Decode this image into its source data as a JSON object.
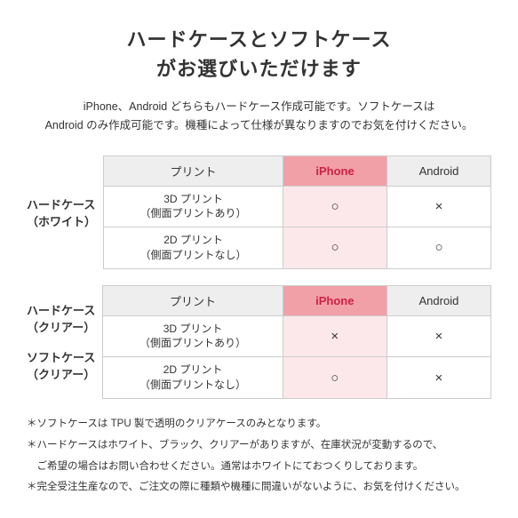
{
  "title": {
    "line1": "ハードケースとソフトケース",
    "line2": "がお選びいただけます"
  },
  "description": "iPhone、Android どちらもハードケース作成可能です。ソフトケースは\nAndroid のみ作成可能です。機種によって仕様が異なりますのでお気を付けください。",
  "table1": {
    "row_label_line1": "ハードケース",
    "row_label_line2": "（ホワイト）",
    "col_print": "プリント",
    "col_iphone": "iPhone",
    "col_android": "Android",
    "rows": [
      {
        "print_line1": "3D プリント",
        "print_line2": "（側面プリントあり）",
        "iphone": "○",
        "android": "×"
      },
      {
        "print_line1": "2D プリント",
        "print_line2": "（側面プリントなし）",
        "iphone": "○",
        "android": "○"
      }
    ]
  },
  "table2": {
    "row_label_line1": "ハードケース",
    "row_label_line2": "（クリアー）",
    "row_label2_line1": "ソフトケース",
    "row_label2_line2": "（クリアー）",
    "col_print": "プリント",
    "col_iphone": "iPhone",
    "col_android": "Android",
    "rows": [
      {
        "print_line1": "3D プリント",
        "print_line2": "（側面プリントあり）",
        "iphone": "×",
        "android": "×"
      },
      {
        "print_line1": "2D プリント",
        "print_line2": "（側面プリントなし）",
        "iphone": "○",
        "android": "×"
      }
    ]
  },
  "notes": [
    "＊ソフトケースは TPU 製で透明のクリアケースのみとなります。",
    "＊ハードケースはホワイト、ブラック、クリアーがありますが、在庫状況が変動するので、",
    "　ご希望の場合はお問い合わせください。通常はホワイトにておつくりしております。",
    "＊完全受注生産なので、ご注文の際に種類や機種に間違いがないように、お気を付けください。"
  ]
}
